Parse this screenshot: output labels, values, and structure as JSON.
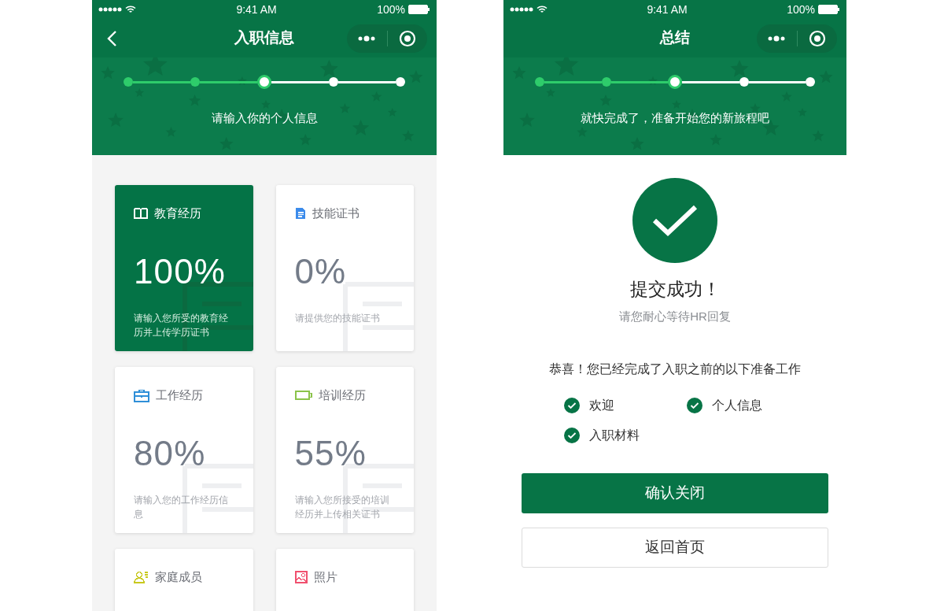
{
  "onboarding_screen": {
    "status_bar": {
      "time": "9:41 AM",
      "battery": "100%"
    },
    "nav": {
      "title": "入职信息",
      "back_button": true
    },
    "progress": {
      "steps": [
        {
          "completed": true,
          "selected": false
        },
        {
          "completed": true,
          "selected": false
        },
        {
          "completed": true,
          "selected": true
        },
        {
          "completed": false,
          "selected": false
        },
        {
          "completed": false,
          "selected": false
        }
      ],
      "caption": "请输入你的个人信息"
    },
    "cards": [
      {
        "kind": "book",
        "title": "教育经历",
        "percent": "100%",
        "description": "请输入您所受的教育经历并上传学历证书",
        "selected": true,
        "color": "#ffffff"
      },
      {
        "kind": "document",
        "title": "技能证书",
        "percent": "0%",
        "description": "请提供您的技能证书",
        "selected": false,
        "color": "#3b8beb"
      },
      {
        "kind": "briefcase",
        "title": "工作经历",
        "percent": "80%",
        "description": "请输入您的工作经历信息",
        "selected": false,
        "color": "#2f8fd8"
      },
      {
        "kind": "battery",
        "title": "培训经历",
        "percent": "55%",
        "description": "请输入您所接受的培训经历并上传相关证书",
        "selected": false,
        "color": "#8bc34a"
      },
      {
        "kind": "contacts",
        "title": "家庭成员",
        "selected": false,
        "color": "#c8c81e"
      },
      {
        "kind": "photo",
        "title": "照片",
        "selected": false,
        "color": "#f0506e"
      }
    ]
  },
  "summary_screen": {
    "status_bar": {
      "time": "9:41 AM",
      "battery": "100%"
    },
    "nav": {
      "title": "总结",
      "back_button": false
    },
    "progress": {
      "steps": [
        {
          "completed": true,
          "selected": false
        },
        {
          "completed": true,
          "selected": false
        },
        {
          "completed": true,
          "selected": true
        },
        {
          "completed": false,
          "selected": false
        },
        {
          "completed": false,
          "selected": false
        }
      ],
      "caption": "就快完成了，准备开始您的新旅程吧"
    },
    "result": {
      "title": "提交成功！",
      "subtitle": "请您耐心等待HR回复"
    },
    "message": "恭喜！您已经完成了入职之前的以下准备工作",
    "checklist": [
      {
        "label": "欢迎",
        "checked": true
      },
      {
        "label": "个人信息",
        "checked": true
      },
      {
        "label": "入职材料",
        "checked": true
      }
    ],
    "buttons": [
      {
        "label": "确认关闭",
        "kind": "primary"
      },
      {
        "label": "返回首页",
        "kind": "secondary"
      }
    ]
  }
}
